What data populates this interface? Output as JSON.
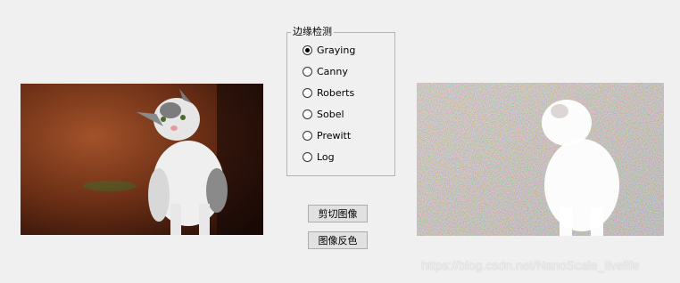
{
  "groupbox": {
    "title": "边缘检测"
  },
  "radios": [
    {
      "label": "Graying",
      "checked": true
    },
    {
      "label": "Canny",
      "checked": false
    },
    {
      "label": "Roberts",
      "checked": false
    },
    {
      "label": "Sobel",
      "checked": false
    },
    {
      "label": "Prewitt",
      "checked": false
    },
    {
      "label": "Log",
      "checked": false
    }
  ],
  "buttons": {
    "crop_label": "剪切图像",
    "invert_label": "图像反色"
  },
  "images": {
    "left_icon": "cat-photo-icon",
    "right_icon": "cat-processed-noise-icon"
  },
  "watermark": "https://blog.csdn.net/NanoScale_livelife"
}
